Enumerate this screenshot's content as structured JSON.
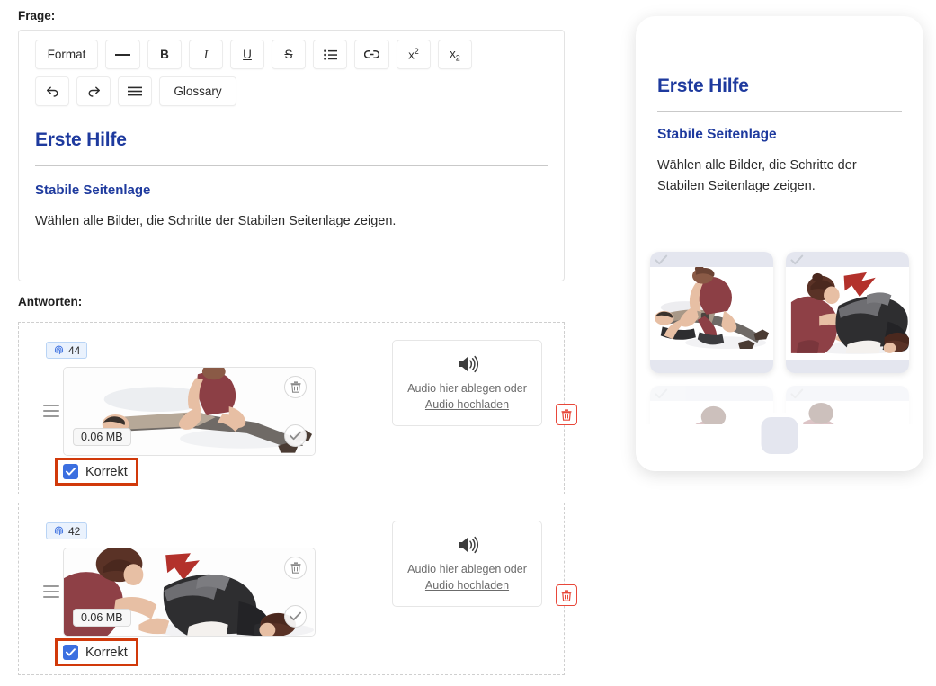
{
  "labels": {
    "frage": "Frage:",
    "antworten": "Antworten:"
  },
  "editor": {
    "toolbar": {
      "row1": [
        {
          "label": "Format",
          "icon": "format-dropdown-icon"
        },
        {
          "label": "—",
          "icon": "horizontal-rule-icon"
        },
        {
          "label": "B",
          "icon": "bold-icon"
        },
        {
          "label": "I",
          "icon": "italic-icon"
        },
        {
          "label": "U",
          "icon": "underline-icon"
        },
        {
          "label": "S",
          "icon": "strikethrough-icon"
        },
        {
          "label": "",
          "icon": "bullet-list-icon"
        },
        {
          "label": "",
          "icon": "link-icon"
        },
        {
          "label": "x2",
          "icon": "superscript-icon"
        },
        {
          "label": "x2",
          "icon": "subscript-icon"
        }
      ],
      "row2": [
        {
          "label": "",
          "icon": "undo-icon"
        },
        {
          "label": "",
          "icon": "redo-icon"
        },
        {
          "label": "",
          "icon": "align-icon"
        },
        {
          "label": "Glossary",
          "icon": "glossary-icon"
        }
      ]
    },
    "content": {
      "heading": "Erste Hilfe",
      "subheading": "Stabile Seitenlage",
      "paragraph": "Wählen alle Bilder, die Schritte der Stabilen Seitenlage zeigen."
    }
  },
  "answers": [
    {
      "badge_count": "44",
      "badge_icon": "fingerprint-icon",
      "file_size": "0.06 MB",
      "correct_label": "Korrekt",
      "correct_checked": true,
      "audio": {
        "icon": "speaker-icon",
        "drop_text": "Audio hier ablegen oder",
        "upload_link": "Audio hochladen"
      },
      "image_alt": "erste-hilfe-schritt-1"
    },
    {
      "badge_count": "42",
      "badge_icon": "fingerprint-icon",
      "file_size": "0.06 MB",
      "correct_label": "Korrekt",
      "correct_checked": true,
      "audio": {
        "icon": "speaker-icon",
        "drop_text": "Audio hier ablegen oder",
        "upload_link": "Audio hochladen"
      },
      "image_alt": "erste-hilfe-schritt-2"
    }
  ],
  "preview": {
    "heading": "Erste Hilfe",
    "subheading": "Stabile Seitenlage",
    "paragraph": "Wählen alle Bilder, die Schritte der Stabilen Seitenlage zeigen.",
    "cards": [
      {
        "alt": "preview-image-1",
        "faded": false
      },
      {
        "alt": "preview-image-2",
        "faded": false
      },
      {
        "alt": "preview-image-3",
        "faded": true
      },
      {
        "alt": "preview-image-4",
        "faded": true
      }
    ]
  },
  "colors": {
    "heading_blue": "#1e3a9e",
    "highlight_red": "#d1390a",
    "checkbox_blue": "#3b6fe0",
    "delete_red": "#e8483a",
    "badge_bg": "#eaf2fd",
    "badge_border": "#b9d4f5"
  }
}
